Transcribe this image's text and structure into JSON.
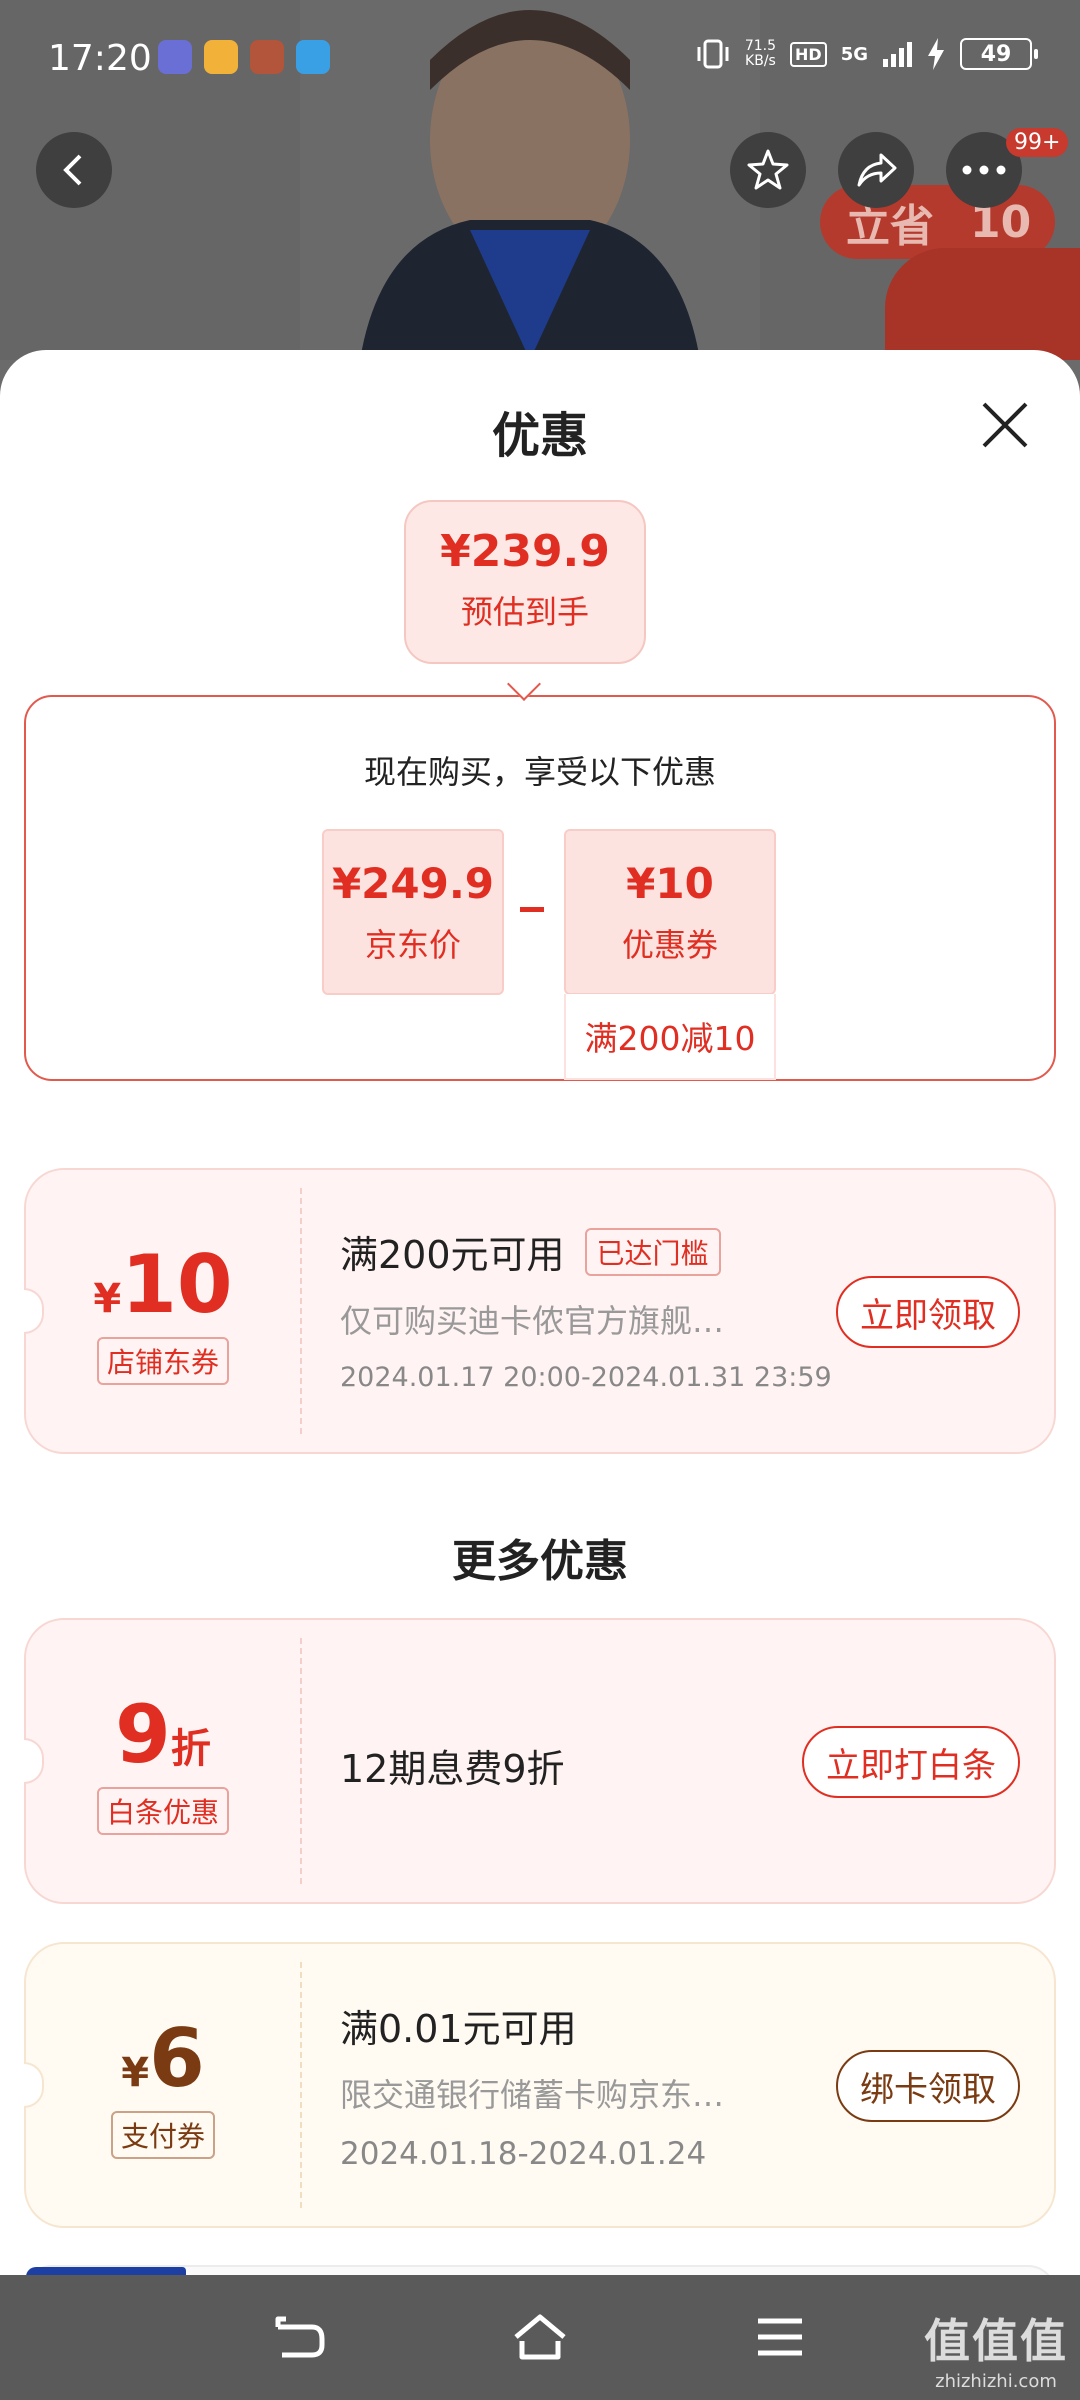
{
  "status_bar": {
    "time": "17:20",
    "net_speed_value": "71.5",
    "net_speed_unit": "KB/s",
    "hd": "HD",
    "network": "5G",
    "battery": "49"
  },
  "header": {
    "cart_badge": "99+",
    "promo_pill_left": "立省",
    "promo_pill_right": "10"
  },
  "sheet": {
    "title": "优惠",
    "estimate": {
      "price": "¥239.9",
      "label": "预估到手"
    },
    "calc": {
      "title": "现在购买，享受以下优惠",
      "jd_price": {
        "value": "¥249.9",
        "label": "京东价"
      },
      "coupon": {
        "value": "¥10",
        "label": "优惠券",
        "condition": "满200减10"
      }
    },
    "coupons": [
      {
        "currency": "¥",
        "amount": "10",
        "unit": "",
        "tag": "店铺东券",
        "title": "满200元可用",
        "badge": "已达门槛",
        "desc": "仅可购买迪卡侬官方旗舰…",
        "date": "2024.01.17 20:00-2024.01.31 23:59",
        "button": "立即领取"
      }
    ],
    "more_title": "更多优惠",
    "more": [
      {
        "currency": "",
        "amount": "9",
        "unit": "折",
        "tag": "白条优惠",
        "title": "12期息费9折",
        "button": "立即打白条"
      },
      {
        "currency": "¥",
        "amount": "6",
        "unit": "",
        "tag": "支付券",
        "title": "满0.01元可用",
        "desc": "限交通银行储蓄卡购京东…",
        "date": "2024.01.18-2024.01.24",
        "button": "绑卡领取"
      }
    ]
  },
  "watermark": {
    "main": "值值值",
    "sub": "zhizhizhi.com"
  },
  "colors": {
    "accent": "#e02f22",
    "brown": "#7a3b12"
  },
  "icons": [
    "back-arrow-icon",
    "star-icon",
    "share-icon",
    "more-icon",
    "close-icon",
    "nav-back-icon",
    "nav-home-icon",
    "nav-menu-icon"
  ]
}
